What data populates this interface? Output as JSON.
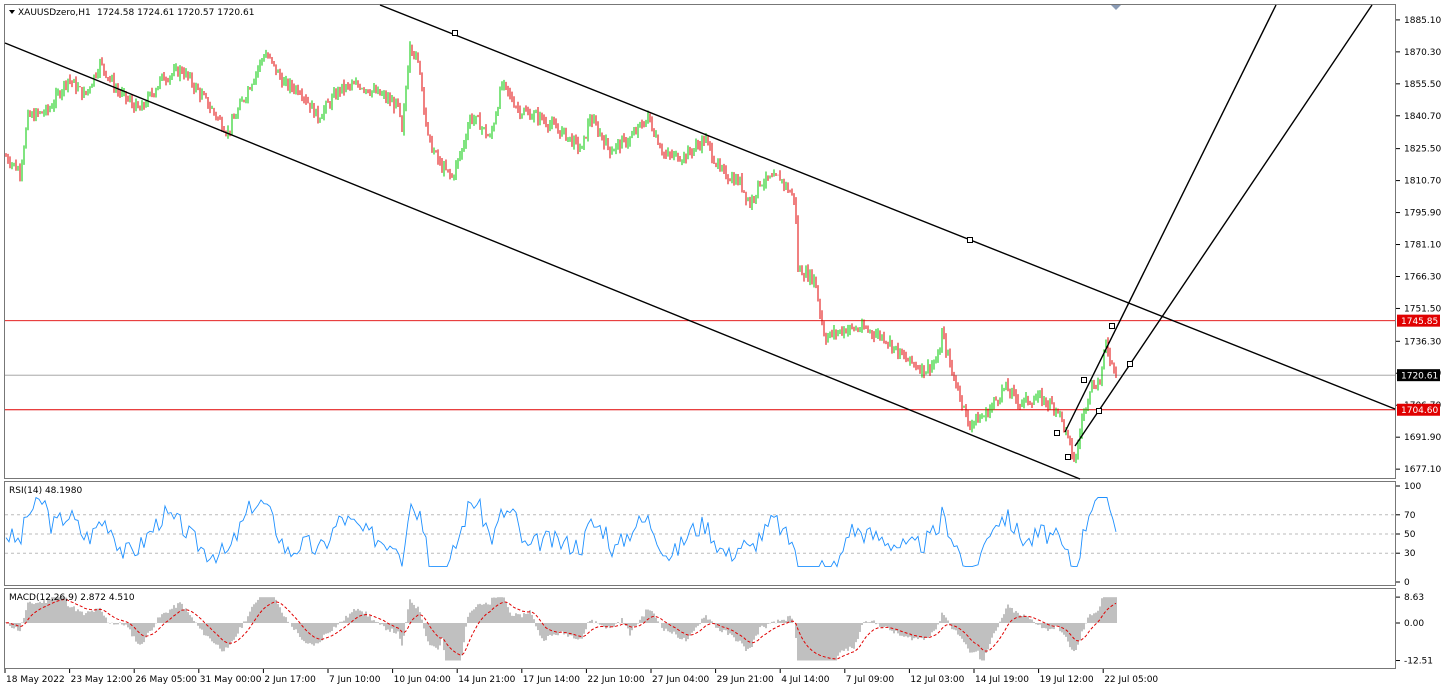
{
  "main_pane": {
    "symbol": "XAUUSDzero,H1",
    "ohlc": "1724.58 1724.61 1720.57 1720.61",
    "ylim": [
      1673.0,
      1892.0
    ],
    "price_ticks": [
      "1885.10",
      "1870.30",
      "1855.50",
      "1840.70",
      "1825.50",
      "1810.70",
      "1795.90",
      "1781.10",
      "1766.30",
      "1751.50",
      "1736.30",
      "1721.50",
      "1706.70",
      "1691.90",
      "1677.10"
    ],
    "current_price": "1720.61",
    "hlines": [
      {
        "label": "1745.85",
        "value": 1745.85,
        "color": "#e00000"
      },
      {
        "label": "1720.61",
        "value": 1720.61,
        "color": "#9a9a9a"
      },
      {
        "label": "1704.60",
        "value": 1704.6,
        "color": "#e00000"
      }
    ],
    "colors": {
      "bull": "#00c800",
      "bear": "#e00000",
      "lines": "#000000"
    }
  },
  "rsi_pane": {
    "label": "RSI(14) 48.1980",
    "ticks": [
      "100",
      "70",
      "50",
      "30",
      "0"
    ],
    "color": "#1e90ff"
  },
  "macd_pane": {
    "label": "MACD(12,26,9) 2.872 4.510",
    "ticks": [
      "8.63",
      "0.00",
      "-12.51"
    ],
    "hist_color": "#c0c0c0",
    "signal_color": "#e00000"
  },
  "time_axis": [
    "18 May 2022",
    "23 May 12:00",
    "26 May 05:00",
    "31 May 00:00",
    "2 Jun 17:00",
    "7 Jun 10:00",
    "10 Jun 04:00",
    "14 Jun 21:00",
    "17 Jun 14:00",
    "22 Jun 10:00",
    "27 Jun 04:00",
    "29 Jun 21:00",
    "4 Jul 14:00",
    "7 Jul 09:00",
    "12 Jul 03:00",
    "14 Jul 19:00",
    "19 Jul 12:00",
    "22 Jul 05:00"
  ]
}
